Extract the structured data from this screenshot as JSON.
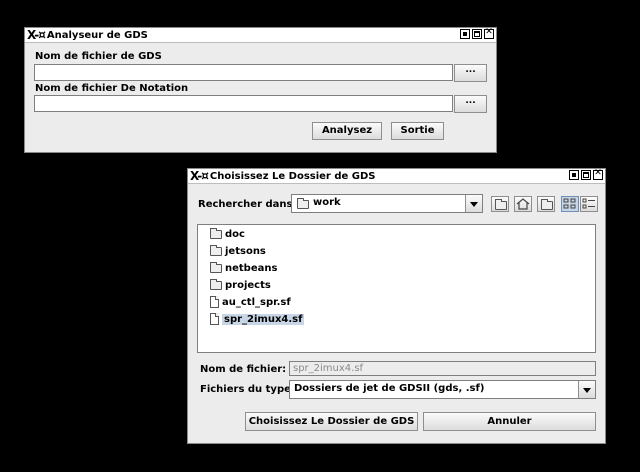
{
  "analyzer": {
    "title_logo": "X-¤",
    "title": "Analyseur de GDS",
    "gds_label": "Nom de fichier de GDS",
    "gds_value": "",
    "notation_label": "Nom de fichier De Notation",
    "notation_value": "",
    "browse_label": "...",
    "analyze_button": "Analysez",
    "exit_button": "Sortie"
  },
  "chooser": {
    "title_logo": "X-¤",
    "title": "Choisissez Le Dossier de GDS",
    "look_in_label": "Rechercher dans :",
    "look_in_value": "work",
    "toolbar_icons": [
      "up-folder-icon",
      "home-icon",
      "new-folder-icon",
      "list-view-icon",
      "details-view-icon"
    ],
    "files": [
      {
        "name": "doc",
        "type": "folder"
      },
      {
        "name": "jetsons",
        "type": "folder"
      },
      {
        "name": "netbeans",
        "type": "folder"
      },
      {
        "name": "projects",
        "type": "folder"
      },
      {
        "name": "au_ctl_spr.sf",
        "type": "file"
      },
      {
        "name": "spr_2imux4.sf",
        "type": "file",
        "selected": true
      }
    ],
    "filename_label": "Nom de fichier:",
    "filename_value": "spr_2imux4.sf",
    "filetype_label": "Fichiers du type :",
    "filetype_value": "Dossiers de jet de GDSII (gds, .sf)",
    "choose_button": "Choisissez Le Dossier de GDS",
    "cancel_button": "Annuler"
  }
}
